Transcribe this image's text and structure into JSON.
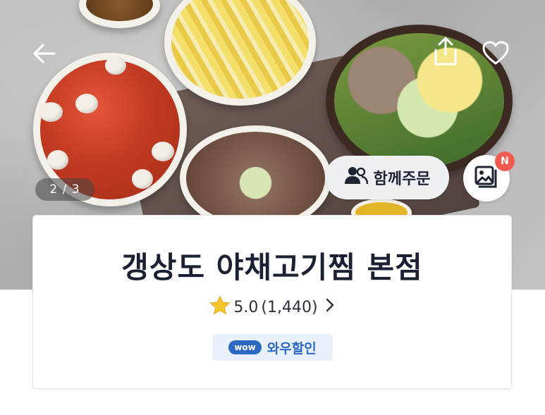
{
  "header": {
    "back_icon": "arrow-left-icon",
    "share_icon": "share-icon",
    "favorite_icon": "heart-icon"
  },
  "gallery": {
    "page_indicator": "2 / 3",
    "current_page": 2,
    "total_pages": 3
  },
  "actions": {
    "group_order_label": "함께주문",
    "group_order_icon": "people-icon",
    "photo_review_icon": "photo-gallery-icon",
    "new_badge": "N"
  },
  "store": {
    "name": "갱상도 야채고기찜 본점",
    "rating": "5.0",
    "review_count": "(1,440)",
    "rating_icon": "star-icon",
    "wow_badge_pill": "wow",
    "wow_badge_text": "와우할인"
  },
  "colors": {
    "accent_blue": "#2d68c4",
    "badge_red": "#f05a4f",
    "star_yellow": "#f7c52b",
    "title_text": "#1b2133"
  }
}
